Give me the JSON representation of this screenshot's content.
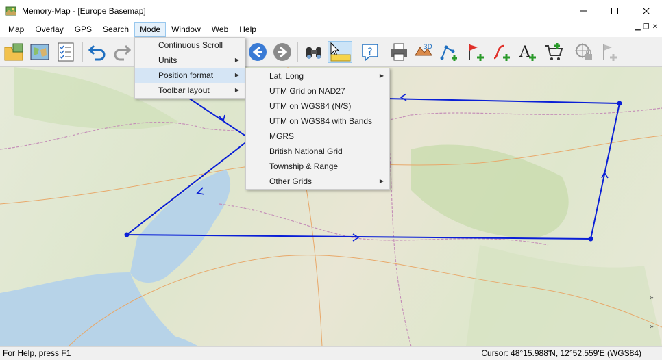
{
  "window": {
    "title": "Memory-Map - [Europe Basemap]"
  },
  "menubar": {
    "items": [
      {
        "label": "Map"
      },
      {
        "label": "Overlay"
      },
      {
        "label": "GPS"
      },
      {
        "label": "Search"
      },
      {
        "label": "Mode"
      },
      {
        "label": "Window"
      },
      {
        "label": "Web"
      },
      {
        "label": "Help"
      }
    ]
  },
  "mode_menu": {
    "items": [
      {
        "label": "Continuous Scroll",
        "submenu": false
      },
      {
        "label": "Units",
        "submenu": true
      },
      {
        "label": "Position format",
        "submenu": true
      },
      {
        "label": "Toolbar layout",
        "submenu": true
      }
    ]
  },
  "position_submenu": {
    "items": [
      {
        "label": "Lat, Long",
        "submenu": true
      },
      {
        "label": "UTM Grid on NAD27",
        "submenu": false
      },
      {
        "label": "UTM on WGS84 (N/S)",
        "submenu": false
      },
      {
        "label": "UTM on WGS84 with Bands",
        "submenu": false
      },
      {
        "label": "MGRS",
        "submenu": false
      },
      {
        "label": "British National Grid",
        "submenu": false
      },
      {
        "label": "Township & Range",
        "submenu": false
      },
      {
        "label": "Other Grids",
        "submenu": true
      }
    ]
  },
  "statusbar": {
    "help": "For Help, press F1",
    "cursor": "Cursor: 48°15.988'N, 12°52.559'E (WGS84)"
  },
  "colors": {
    "route": "#0a1fd6",
    "accent": "#99c8ee"
  }
}
